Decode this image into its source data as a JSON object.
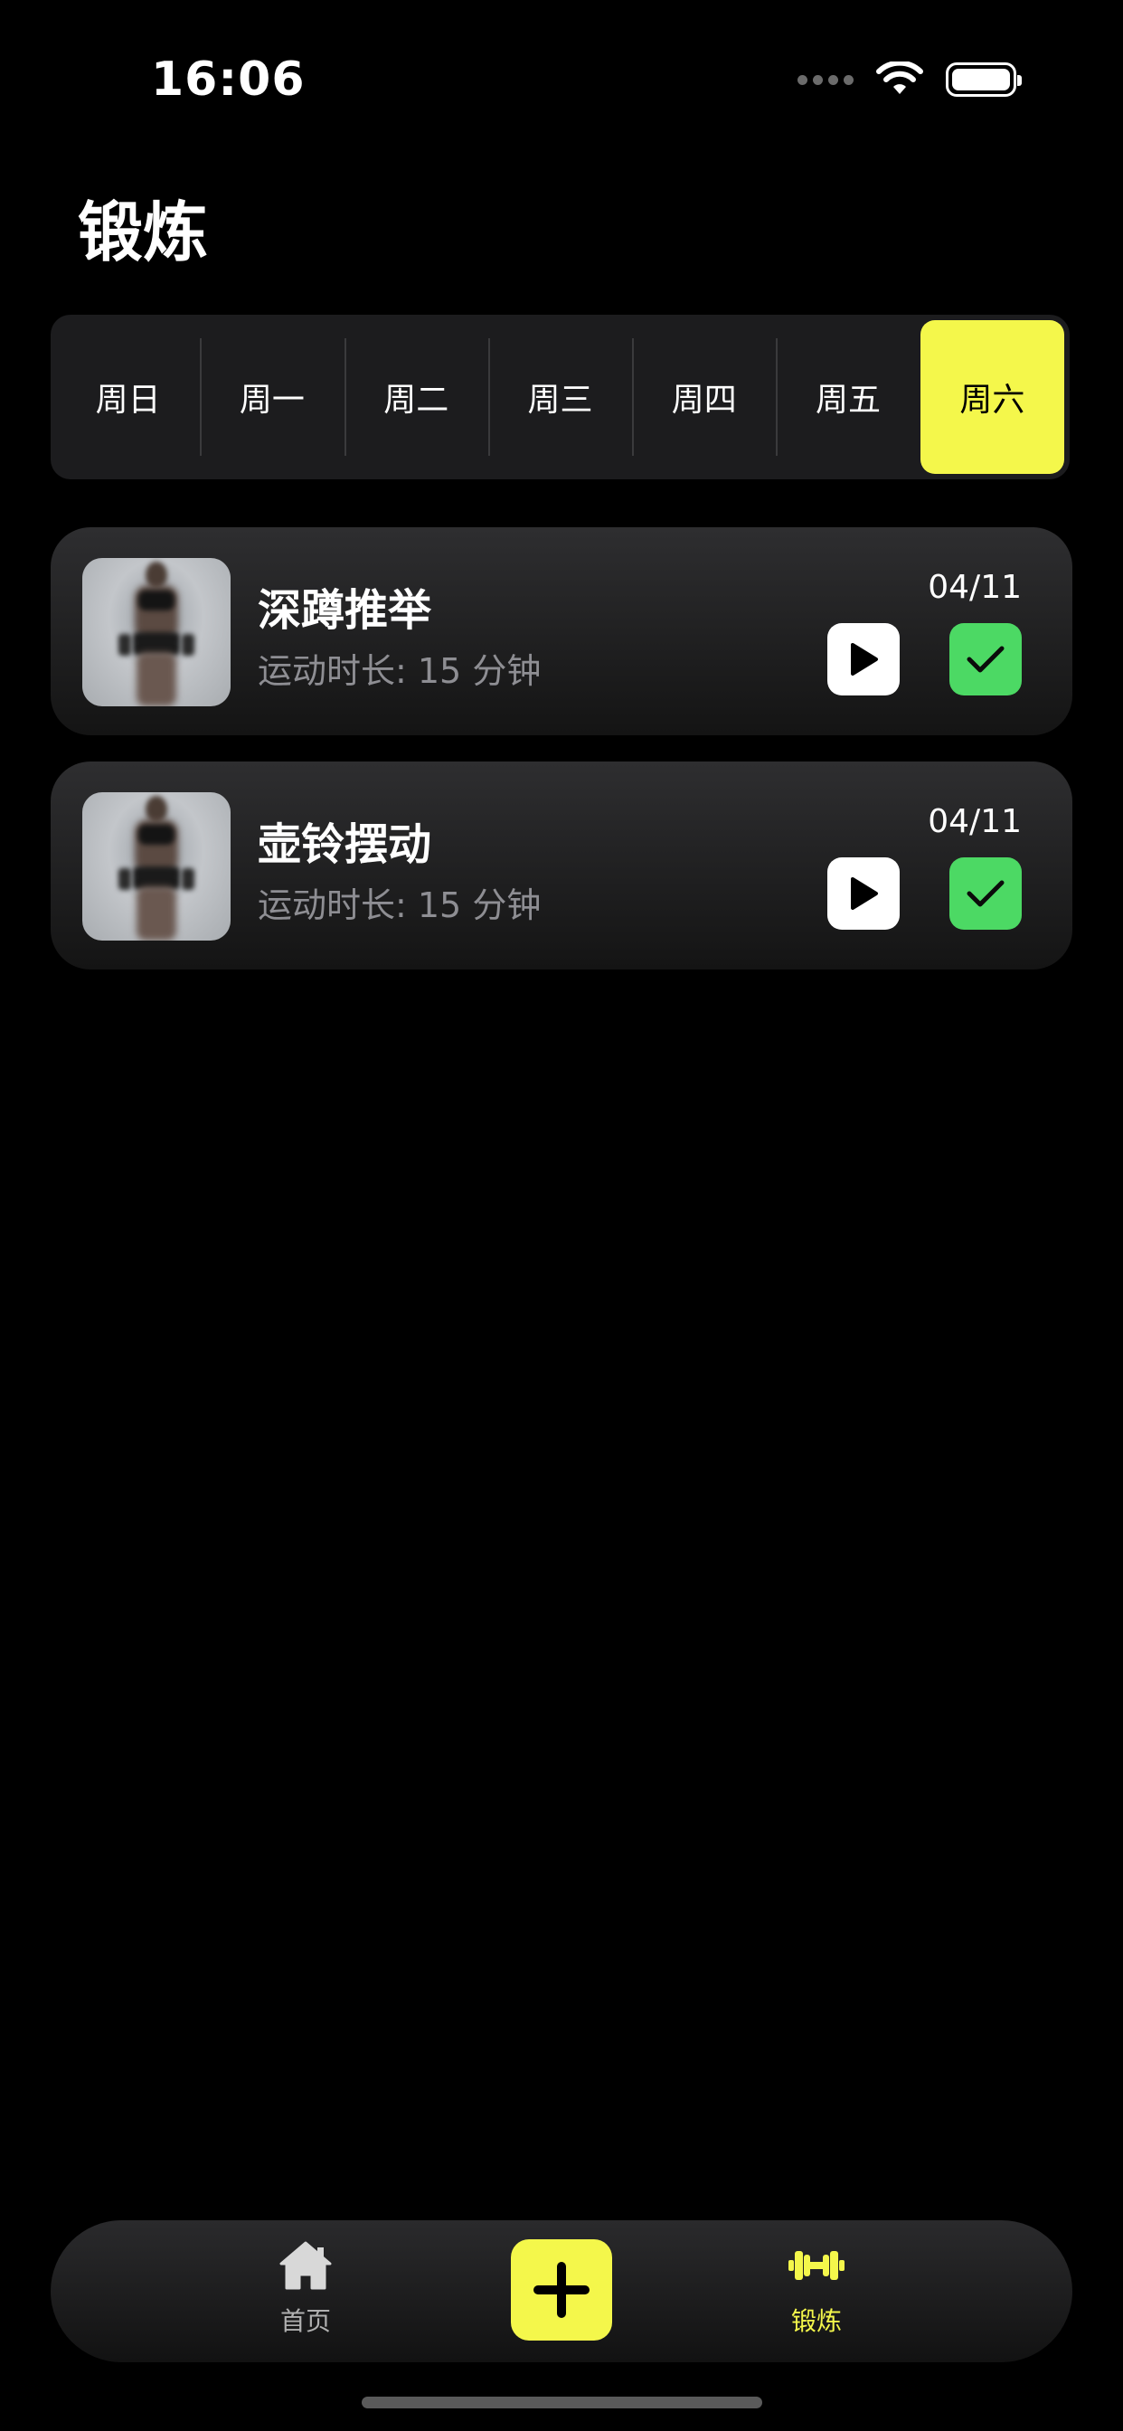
{
  "status_bar": {
    "time": "16:06"
  },
  "page": {
    "title": "锻炼"
  },
  "days": {
    "items": [
      "周日",
      "周一",
      "周二",
      "周三",
      "周四",
      "周五",
      "周六"
    ],
    "selected": "周六"
  },
  "workouts": [
    {
      "name": "深蹲推举",
      "duration": "运动时长: 15 分钟",
      "date": "04/11"
    },
    {
      "name": "壶铃摆动",
      "duration": "运动时长: 15 分钟",
      "date": "04/11"
    }
  ],
  "tab_bar": {
    "home_label": "首页",
    "workout_label": "锻炼",
    "active_tab": "锻炼"
  },
  "colors": {
    "accent": "#f4f74b",
    "complete": "#4cd964",
    "background": "#000000"
  },
  "icons": {
    "home": "home-icon",
    "add": "plus-icon",
    "workout": "dumbbell-icon",
    "play": "play-icon",
    "check": "checkmark-icon"
  }
}
